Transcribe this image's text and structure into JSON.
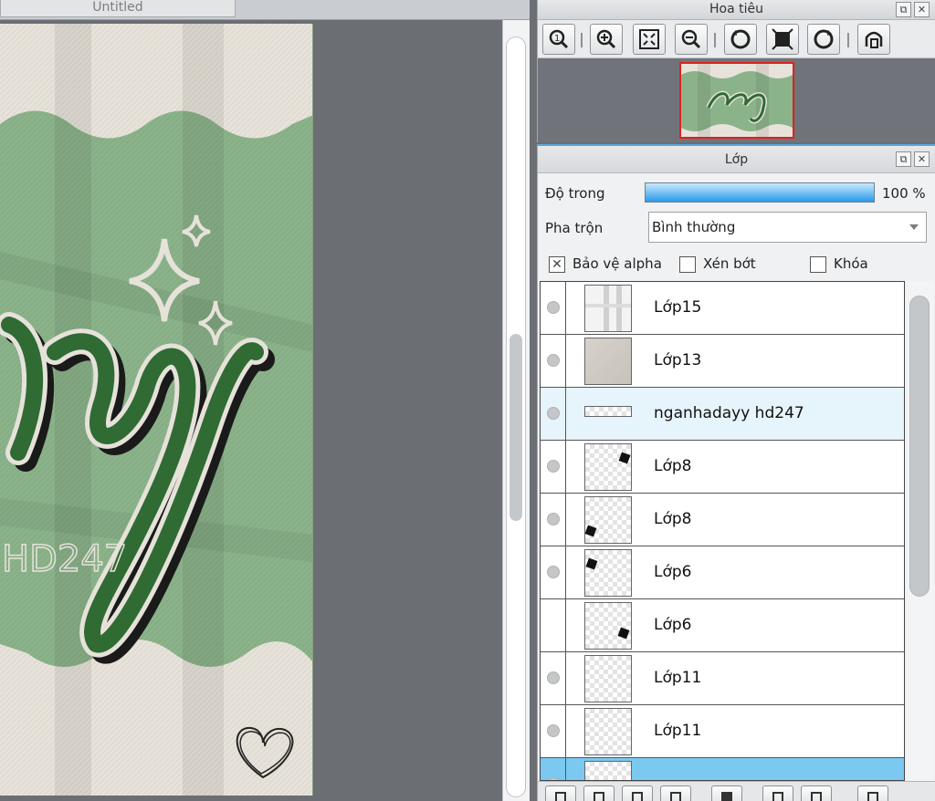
{
  "document": {
    "tab_title": "Untitled"
  },
  "navigator": {
    "title": "Hoa tiêu",
    "tools": [
      "actual-size-icon",
      "zoom-in-icon",
      "fit-window-icon",
      "zoom-out-icon",
      "rotate-left-icon",
      "fit-canvas-icon",
      "rotate-right-icon",
      "flip-icon"
    ]
  },
  "layers_panel": {
    "title": "Lớp",
    "opacity_label": "Độ trong",
    "opacity_value": "100 %",
    "opacity_fraction": 1.0,
    "blend_label": "Pha trộn",
    "blend_value": "Bình thường",
    "protect_alpha_label": "Bảo vệ alpha",
    "protect_alpha_checked": true,
    "clipping_label": "Xén bớt",
    "clipping_checked": false,
    "lock_label": "Khóa",
    "lock_checked": false,
    "layers": [
      {
        "name": "Lớp15",
        "visible": true
      },
      {
        "name": "Lớp13",
        "visible": true
      },
      {
        "name": "nganhadayy hd247",
        "visible": true,
        "selected": true
      },
      {
        "name": "Lớp8",
        "visible": true
      },
      {
        "name": "Lớp8",
        "visible": true
      },
      {
        "name": "Lớp6",
        "visible": true
      },
      {
        "name": "Lớp6",
        "visible": false
      },
      {
        "name": "Lớp11",
        "visible": true
      },
      {
        "name": "Lớp11",
        "visible": true
      },
      {
        "name": "",
        "visible": true,
        "active": true
      }
    ]
  },
  "artwork": {
    "watermark_text": "HD247",
    "colors": {
      "green": "#8bb38a",
      "dark_green": "#2f6b33",
      "cream": "#e8e3da",
      "accent_blue": "#2b9ae8",
      "nav_border": "#e02020"
    }
  }
}
